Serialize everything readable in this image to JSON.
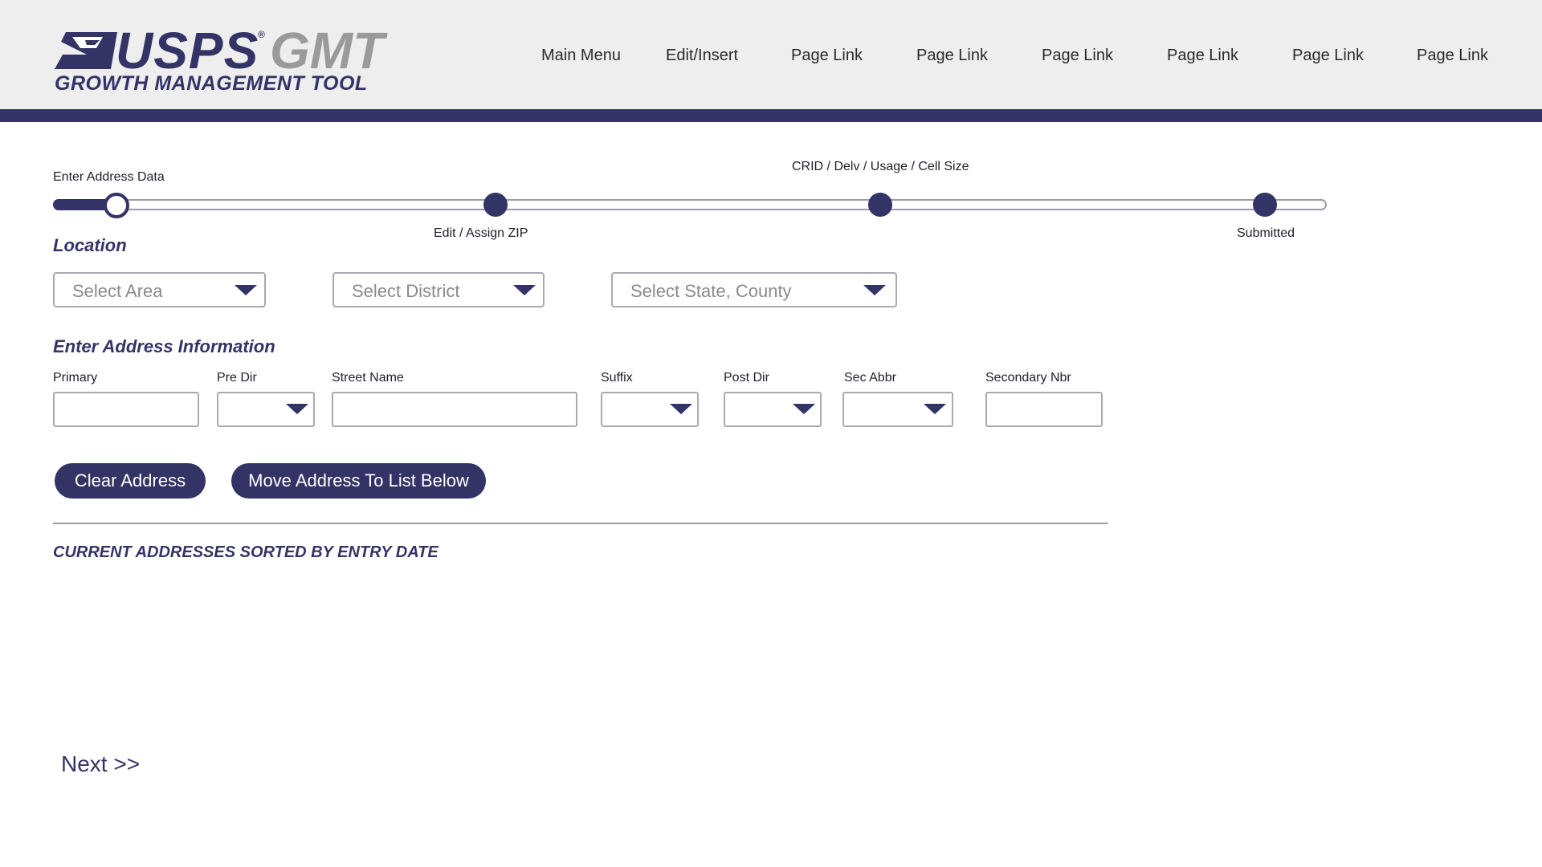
{
  "logo": {
    "brand": "USPS",
    "registered": "®",
    "product": "GMT",
    "tagline": "GROWTH MANAGEMENT TOOL"
  },
  "nav": [
    "Main Menu",
    "Edit/Insert",
    "Page Link",
    "Page Link",
    "Page Link",
    "Page Link",
    "Page Link",
    "Page Link"
  ],
  "progress": {
    "steps": [
      "Enter Address Data",
      "Edit / Assign ZIP",
      "CRID / Delv / Usage / Cell Size",
      "Submitted"
    ],
    "current_step": 1
  },
  "location": {
    "title": "Location",
    "selects": [
      {
        "placeholder": "Select Area"
      },
      {
        "placeholder": "Select District"
      },
      {
        "placeholder": "Select State, County"
      }
    ]
  },
  "address": {
    "title": "Enter Address Information",
    "fields": [
      {
        "label": "Primary",
        "type": "text",
        "value": ""
      },
      {
        "label": "Pre Dir",
        "type": "select",
        "value": ""
      },
      {
        "label": "Street Name",
        "type": "text",
        "value": ""
      },
      {
        "label": "Suffix",
        "type": "select",
        "value": ""
      },
      {
        "label": "Post Dir",
        "type": "select",
        "value": ""
      },
      {
        "label": "Sec Abbr",
        "type": "select",
        "value": ""
      },
      {
        "label": "Secondary Nbr",
        "type": "text",
        "value": ""
      }
    ]
  },
  "buttons": {
    "clear": "Clear Address",
    "move": "Move Address To List Below"
  },
  "list": {
    "title": "CURRENT ADDRESSES SORTED BY ENTRY DATE"
  },
  "next": "Next >>",
  "colors": {
    "brand_navy": "#333366",
    "logo_gray": "#9a9a9a",
    "header_bg": "#eeeeee"
  }
}
